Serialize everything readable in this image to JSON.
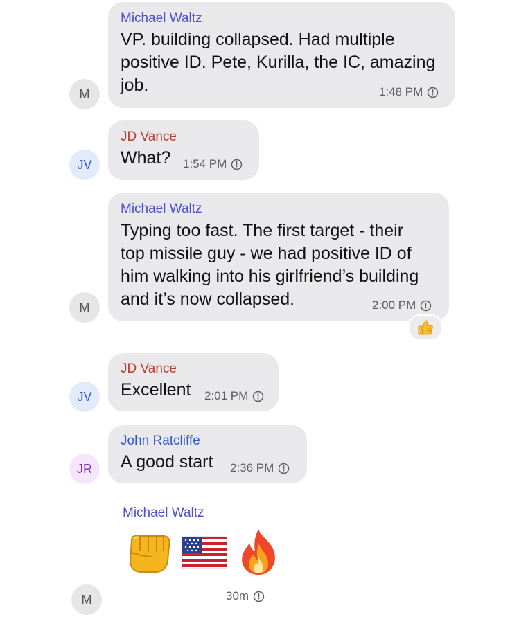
{
  "messages": [
    {
      "sender": "Michael Waltz",
      "avatar": "M",
      "lines": [
        "VP.  building collapsed. Had multiple",
        "positive ID. Pete, Kurilla, the IC, amazing",
        "job."
      ],
      "time": "1:48 PM"
    },
    {
      "sender": "JD Vance",
      "avatar": "JV",
      "lines": [
        "What?"
      ],
      "time": "1:54 PM"
    },
    {
      "sender": "Michael Waltz",
      "avatar": "M",
      "lines": [
        "Typing too fast. The first target - their",
        "top missile guy - we had positive ID of",
        "him walking into his girlfriend’s building",
        "and it’s now collapsed."
      ],
      "time": "2:00 PM",
      "reaction": "thumbs-up-icon"
    },
    {
      "sender": "JD Vance",
      "avatar": "JV",
      "lines": [
        "Excellent"
      ],
      "time": "2:01 PM"
    },
    {
      "sender": "John Ratcliffe",
      "avatar": "JR",
      "lines": [
        "A good start"
      ],
      "time": "2:36 PM"
    },
    {
      "sender": "Michael Waltz",
      "avatar": "M",
      "emojis": [
        "fist-bump-icon",
        "us-flag-icon",
        "fire-icon"
      ],
      "time": "30m"
    }
  ],
  "colors": {
    "bubble": "#e9e9eb",
    "sender_michael_waltz": "#4a4fd6",
    "sender_jd_vance": "#c0392b",
    "sender_john_ratcliffe": "#2f58d6",
    "timestamp": "#5d5d5d"
  }
}
